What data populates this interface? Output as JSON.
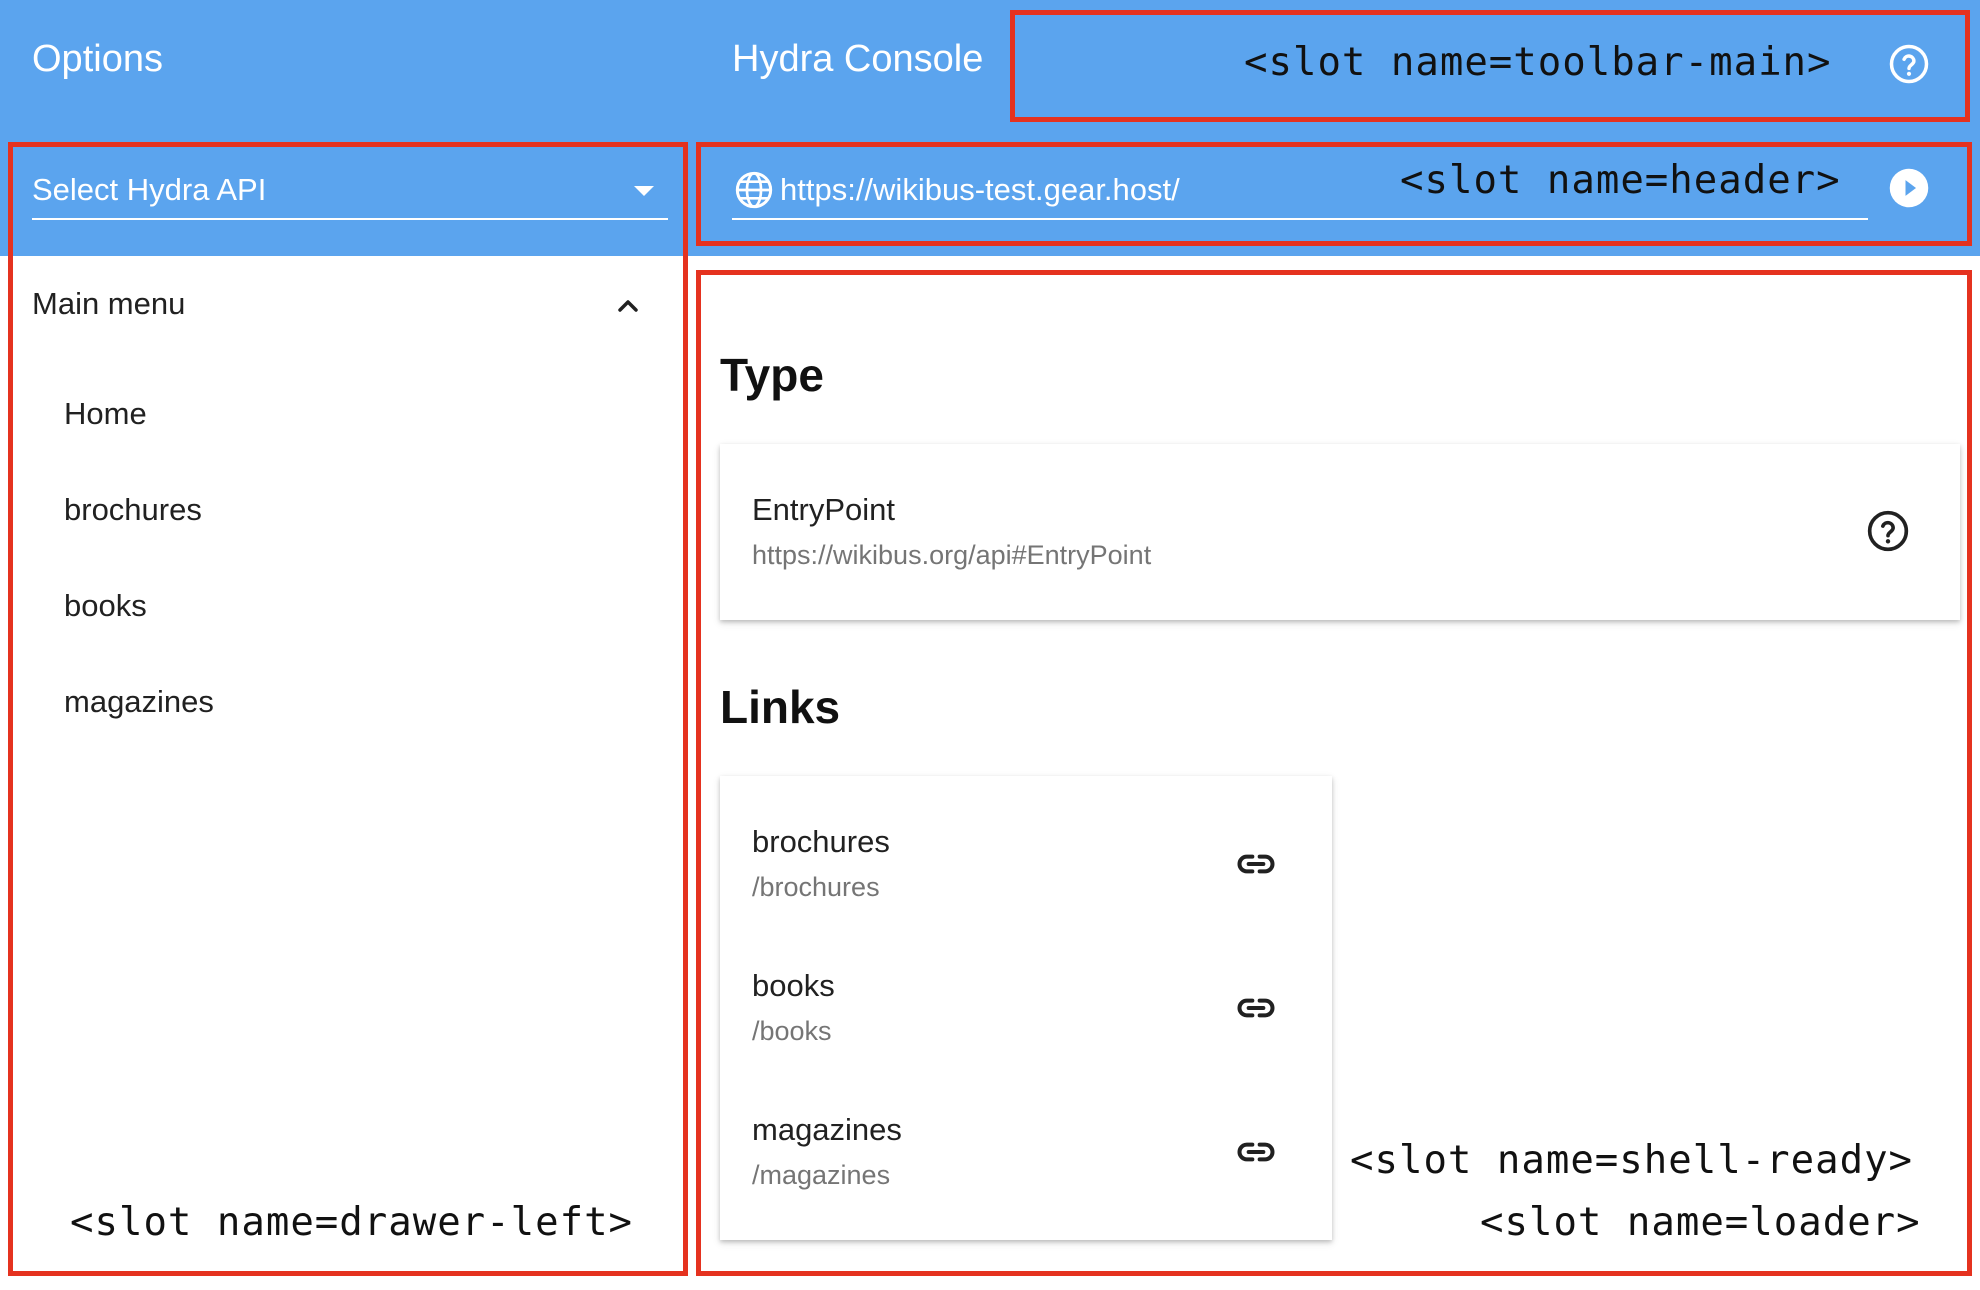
{
  "toolbar": {
    "options_title": "Options",
    "console_title": "Hydra Console",
    "slot_toolbar_main": "<slot name=toolbar-main>"
  },
  "drawer": {
    "api_select_label": "Select Hydra API",
    "main_menu_label": "Main menu",
    "items": [
      {
        "label": "Home"
      },
      {
        "label": "brochures"
      },
      {
        "label": "books"
      },
      {
        "label": "magazines"
      }
    ],
    "slot_drawer_left": "<slot name=drawer-left>"
  },
  "header": {
    "url": "https://wikibus-test.gear.host/",
    "slot_header": "<slot name=header>"
  },
  "content": {
    "type_heading": "Type",
    "type_card": {
      "title": "EntryPoint",
      "subtitle": "https://wikibus.org/api#EntryPoint"
    },
    "links_heading": "Links",
    "links": [
      {
        "title": "brochures",
        "path": "/brochures"
      },
      {
        "title": "books",
        "path": "/books"
      },
      {
        "title": "magazines",
        "path": "/magazines"
      }
    ],
    "slot_shell_ready": "<slot name=shell-ready>",
    "slot_loader": "<slot name=loader>"
  },
  "colors": {
    "primary": "#5ba4ee",
    "outline": "#e5321f"
  },
  "icons": [
    "help-circle-icon",
    "chevron-down-icon",
    "chevron-up-icon",
    "globe-icon",
    "play-circle-icon",
    "link-icon"
  ]
}
